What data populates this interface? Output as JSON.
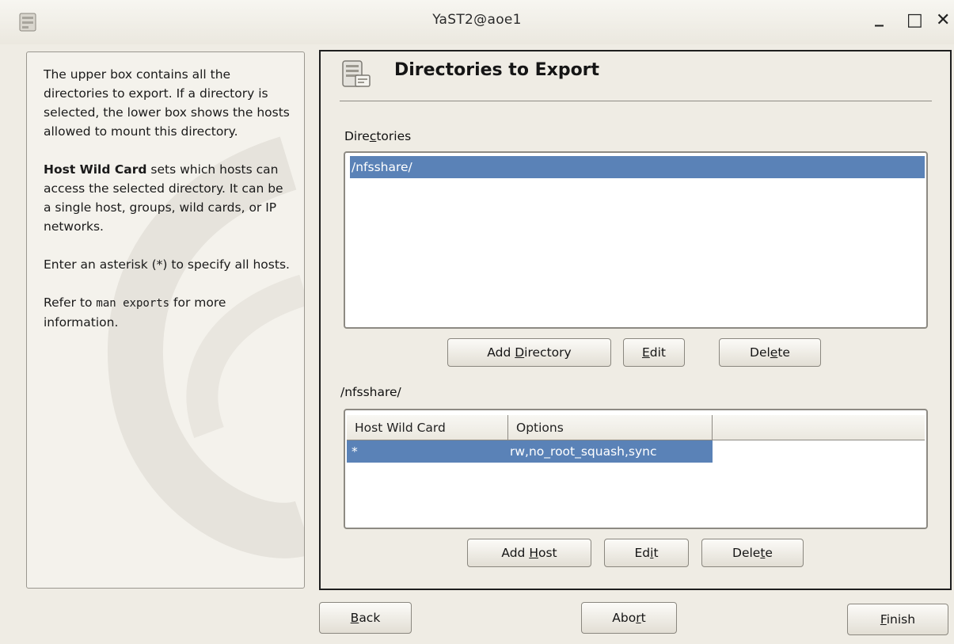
{
  "window": {
    "title": "YaST2@aoe1",
    "minimize_glyph": "_",
    "maximize_glyph": "□",
    "close_glyph": "✕"
  },
  "help": {
    "p1": "The upper box contains all the directories to export. If a directory is selected, the lower box shows the hosts allowed to mount this directory.",
    "p2_bold": "Host Wild Card",
    "p2_rest": " sets which hosts can access the selected directory. It can be a single host, groups, wild cards, or IP networks.",
    "p3": "Enter an asterisk (*) to specify all hosts.",
    "p4_pre": "Refer to ",
    "p4_code": "man exports",
    "p4_post": " for more information."
  },
  "header": {
    "title": "Directories to Export",
    "icon": "server-folder-icon"
  },
  "directories": {
    "label_pre": "Dire",
    "label_u": "c",
    "label_post": "tories",
    "items": [
      "/nfsshare/"
    ]
  },
  "dir_buttons": {
    "add": {
      "pre": "Add ",
      "u": "D",
      "post": "irectory"
    },
    "edit": {
      "pre": "",
      "u": "E",
      "post": "dit"
    },
    "delete": {
      "pre": "Del",
      "u": "e",
      "post": "te"
    }
  },
  "hosts": {
    "label": "/nfsshare/",
    "columns": [
      "Host Wild Card",
      "Options"
    ],
    "rows": [
      {
        "host": "*",
        "options": "rw,no_root_squash,sync"
      }
    ]
  },
  "host_buttons": {
    "add": {
      "pre": "Add ",
      "u": "H",
      "post": "ost"
    },
    "edit": {
      "pre": "Ed",
      "u": "i",
      "post": "t"
    },
    "delete": {
      "pre": "Dele",
      "u": "t",
      "post": "e"
    }
  },
  "nav": {
    "back": {
      "pre": "",
      "u": "B",
      "post": "ack"
    },
    "abort": {
      "pre": "Abo",
      "u": "r",
      "post": "t"
    },
    "finish": {
      "pre": "",
      "u": "F",
      "post": "inish"
    }
  },
  "colors": {
    "selection": "#5a82b7",
    "background": "#efece4"
  }
}
